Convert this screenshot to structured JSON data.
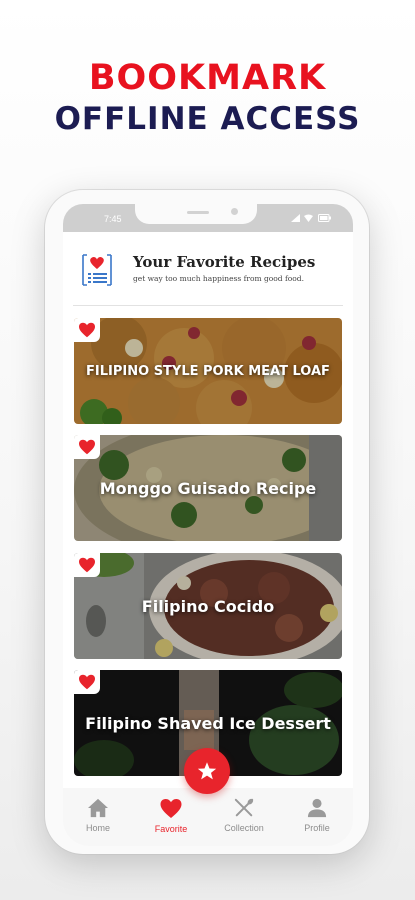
{
  "promo": {
    "line1": "BOOKMARK",
    "line2": "OFFLINE ACCESS"
  },
  "status_bar": {
    "time": "7:45",
    "icons": [
      "wifi-icon",
      "signal-icon",
      "battery-icon"
    ]
  },
  "header": {
    "logo_icon": "heart-list-icon",
    "title": "Your Favorite Recipes",
    "subtitle": "get way too much happiness from good food."
  },
  "recipes": [
    {
      "title": "FILIPINO STYLE PORK MEAT LOAF",
      "favorite": true
    },
    {
      "title": "Monggo Guisado Recipe",
      "favorite": true
    },
    {
      "title": "Filipino Cocido",
      "favorite": true
    },
    {
      "title": "Filipino Shaved Ice Dessert",
      "favorite": true
    }
  ],
  "bottom_nav": {
    "items": [
      {
        "label": "Home",
        "icon": "home-icon",
        "active": false
      },
      {
        "label": "Favorite",
        "icon": "heart-icon",
        "active": true
      },
      {
        "label": "Collection",
        "icon": "fork-knife-icon",
        "active": false
      },
      {
        "label": "Profile",
        "icon": "person-icon",
        "active": false
      }
    ],
    "fab_icon": "star-icon"
  },
  "colors": {
    "accent_red": "#e8242c",
    "headline_red": "#e8121f",
    "headline_navy": "#1c1c52",
    "inactive_gray": "#8d8d8d"
  }
}
